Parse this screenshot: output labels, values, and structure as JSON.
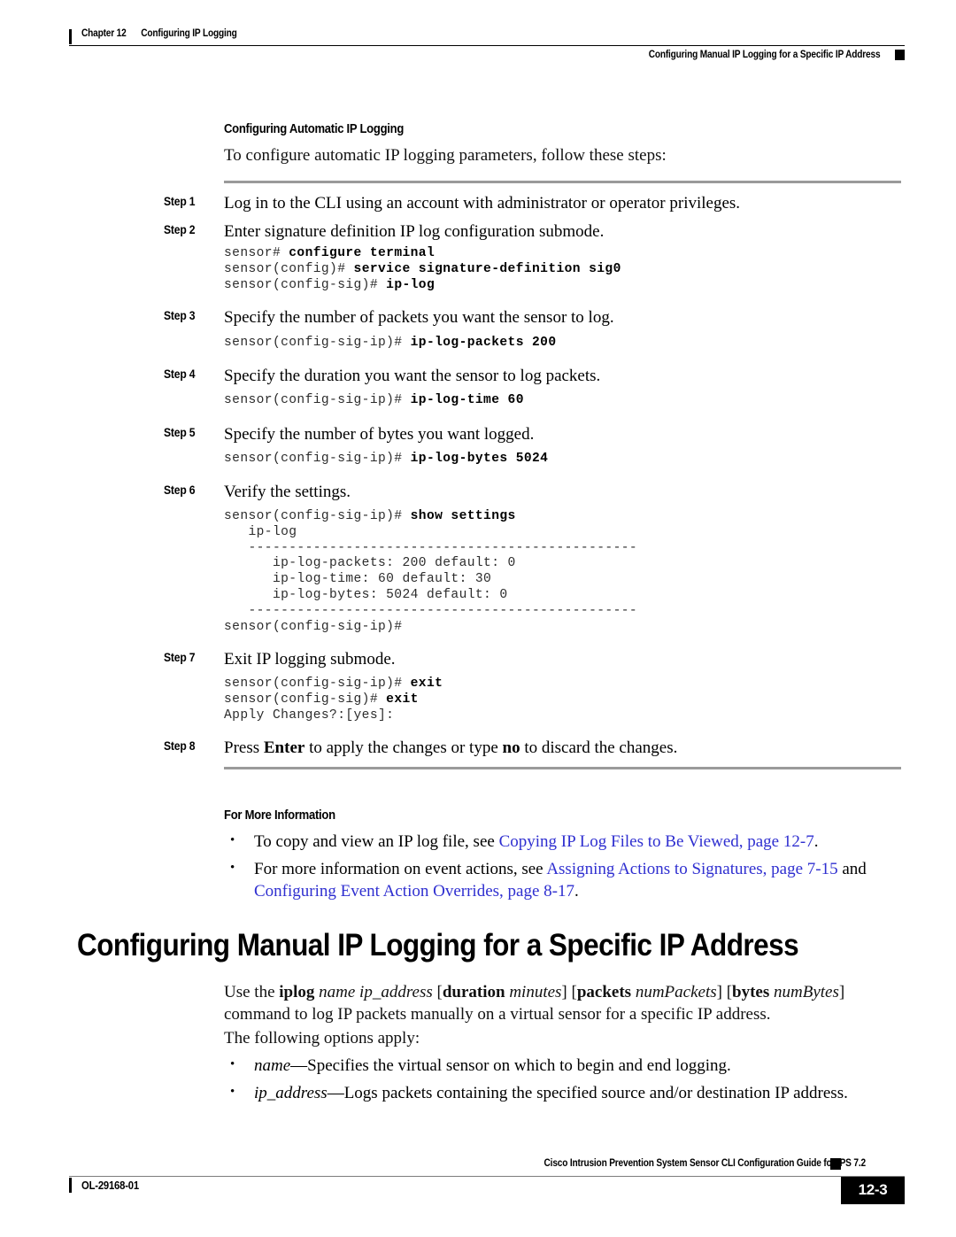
{
  "header": {
    "chapter": "Chapter 12",
    "chapter_title": "Configuring IP Logging",
    "section_title": "Configuring Manual IP Logging for a Specific IP Address"
  },
  "subsection": {
    "heading": "Configuring Automatic IP Logging",
    "intro": "To configure automatic IP logging parameters, follow these steps:"
  },
  "steps": [
    {
      "label": "Step 1",
      "text": "Log in to the CLI using an account with administrator or operator privileges."
    },
    {
      "label": "Step 2",
      "text": "Enter signature definition IP log configuration submode.",
      "code_prompts": [
        "sensor# ",
        "sensor(config)# ",
        "sensor(config-sig)# "
      ],
      "code_cmds": [
        "configure terminal",
        "service signature-definition sig0",
        "ip-log"
      ]
    },
    {
      "label": "Step 3",
      "text": "Specify the number of packets you want the sensor to log.",
      "code_prompts": [
        "sensor(config-sig-ip)# "
      ],
      "code_cmds": [
        "ip-log-packets 200"
      ]
    },
    {
      "label": "Step 4",
      "text": "Specify the duration you want the sensor to log packets.",
      "code_prompts": [
        "sensor(config-sig-ip)# "
      ],
      "code_cmds": [
        "ip-log-time 60"
      ]
    },
    {
      "label": "Step 5",
      "text": "Specify the number of bytes you want logged.",
      "code_prompts": [
        "sensor(config-sig-ip)# "
      ],
      "code_cmds": [
        "ip-log-bytes 5024"
      ]
    },
    {
      "label": "Step 6",
      "text": "Verify the settings."
    },
    {
      "label": "Step 7",
      "text": "Exit IP logging submode."
    },
    {
      "label": "Step 8",
      "text_html": "Press <b>Enter</b> to apply the changes or type <b>no</b> to discard the changes."
    }
  ],
  "show_settings_block": {
    "prompt": "sensor(config-sig-ip)# ",
    "command": "show settings",
    "lines": [
      "   ip-log",
      "   ------------------------------------------------",
      "      ip-log-packets: 200 default: 0",
      "      ip-log-time: 60 default: 30",
      "      ip-log-bytes: 5024 default: 0",
      "   ------------------------------------------------",
      "sensor(config-sig-ip)#"
    ]
  },
  "exit_block": {
    "prompts": [
      "sensor(config-sig-ip)# ",
      "sensor(config-sig)# "
    ],
    "cmds": [
      "exit",
      "exit"
    ],
    "apply_line": "Apply Changes?:[yes]:"
  },
  "for_more_information": {
    "heading": "For More Information",
    "bullets": [
      {
        "pre": "To copy and view an IP log file, see ",
        "link": "Copying IP Log Files to Be Viewed, page 12-7",
        "post": "."
      },
      {
        "pre": "For more information on event actions, see ",
        "link": "Assigning Actions to Signatures, page 7-15",
        "mid": " and ",
        "link2": "Configuring Event Action Overrides, page 8-17",
        "post": "."
      }
    ]
  },
  "main_section": {
    "title": "Configuring Manual IP Logging for a Specific IP Address",
    "syntax_html": "Use the <b>iplog</b> <i>name ip_address</i> [<b>duration</b> <i>minutes</i>] [<b>packets</b> <i>numPackets</i>] [<b>bytes</b> <i>numBytes</i>] command",
    "syntax_line2": "to log IP packets manually on a virtual sensor for a specific IP address.",
    "options_intro": "The following options apply:",
    "option_bullets": [
      {
        "term": "name",
        "desc": "—Specifies the virtual sensor on which to begin and end logging."
      },
      {
        "term": "ip_address",
        "desc": "—Logs packets containing the specified source and/or destination IP address."
      }
    ]
  },
  "footer": {
    "guide_title": "Cisco Intrusion Prevention System Sensor CLI Configuration Guide for IPS 7.2",
    "doc_id": "OL-29168-01",
    "page_number": "12-3"
  },
  "colors": {
    "link": "#2f2fd0",
    "rule_gray": "#9a9a9a"
  }
}
